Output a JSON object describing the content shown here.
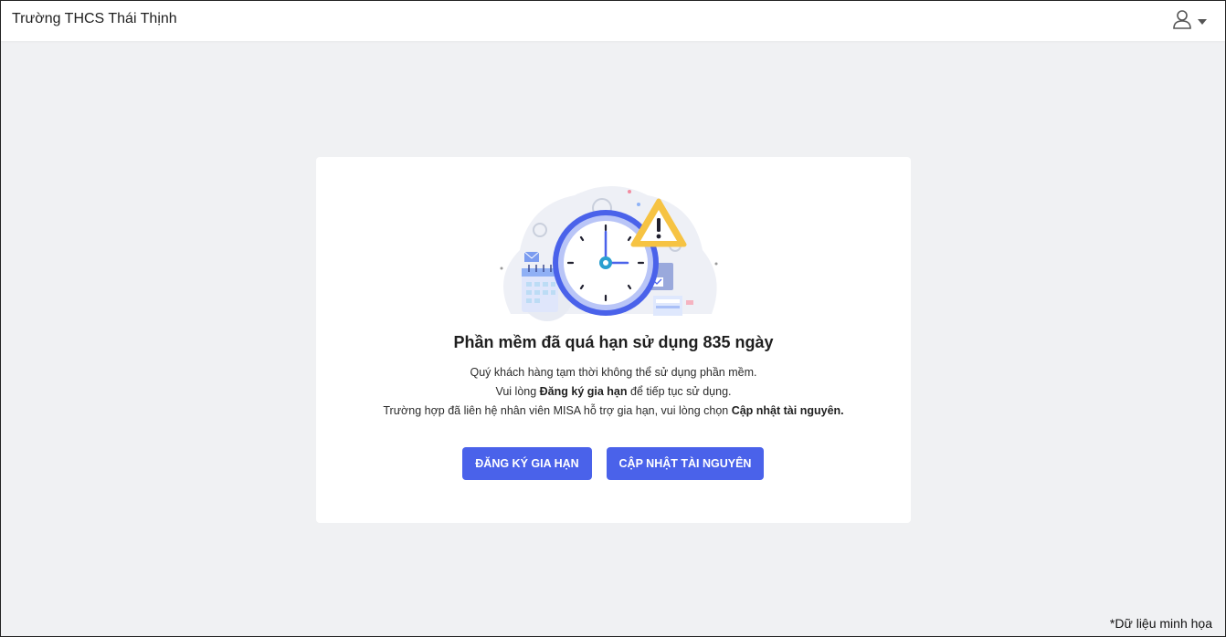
{
  "header": {
    "school_name": "Trường THCS Thái Thịnh",
    "user_icon": "user-icon",
    "dropdown_icon": "caret-down-icon"
  },
  "notice": {
    "illustration": "clock-warning-illustration",
    "title": "Phần mềm đã quá hạn sử dụng 835 ngày",
    "line1": "Quý khách hàng tạm thời không thể sử dụng phần mềm.",
    "line2_prefix": "Vui lòng ",
    "line2_bold": "Đăng ký gia hạn",
    "line2_suffix": " để tiếp tục sử dụng.",
    "line3_prefix": "Trường hợp đã liên hệ nhân viên MISA hỗ trợ gia hạn, vui lòng chọn ",
    "line3_bold": "Cập nhật tài nguyên."
  },
  "actions": {
    "renew_label": "ĐĂNG KÝ GIA HẠN",
    "update_label": "CẬP NHẬT TÀI NGUYÊN"
  },
  "footnote": "*Dữ liệu minh họa",
  "colors": {
    "primary": "#4a62ea",
    "background": "#f0f1f3",
    "warning": "#f6c343"
  }
}
